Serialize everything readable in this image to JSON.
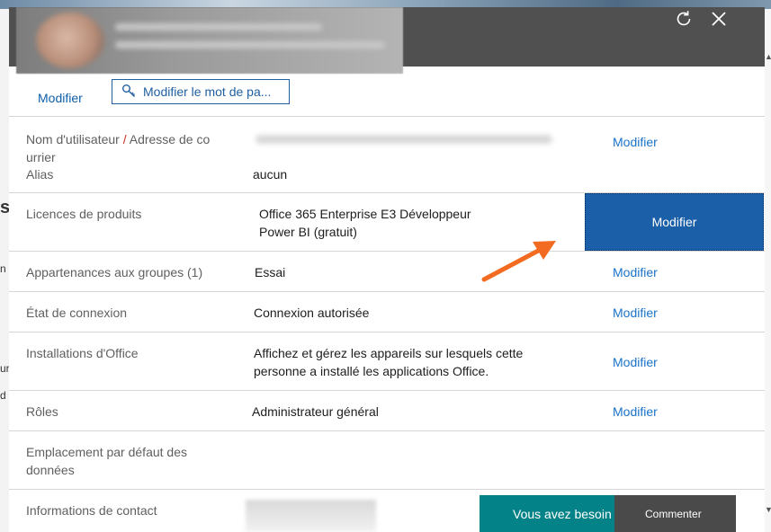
{
  "header": {
    "refresh_icon": "refresh-icon",
    "close_icon": "close-icon"
  },
  "toolbar": {
    "edit_label": "Modifier",
    "change_password_label": "Modifier le mot de pa..."
  },
  "rows": {
    "username": {
      "label_part1": "Nom d'utilisateur",
      "separator": "/",
      "label_part2": "Adresse de co",
      "label_part3": "urrier",
      "alias_label": "Alias",
      "alias_value": "aucun",
      "action": "Modifier"
    },
    "licenses": {
      "label": "Licences de produits",
      "value_line1": "Office 365 Enterprise E3 Développeur",
      "value_line2": "Power BI (gratuit)",
      "action": "Modifier"
    },
    "groups": {
      "label": "Appartenances aux groupes (1)",
      "value": "Essai",
      "action": "Modifier"
    },
    "signin": {
      "label": "État de connexion",
      "value": "Connexion autorisée",
      "action": "Modifier"
    },
    "office_installs": {
      "label": "Installations d'Office",
      "value_line1": "Affichez et gérez les appareils sur lesquels cette",
      "value_line2": "personne a installé les applications Office.",
      "action": "Modifier"
    },
    "roles": {
      "label": "Rôles",
      "value": "Administrateur général",
      "action": "Modifier"
    },
    "data_location": {
      "label_line1": "Emplacement par défaut des",
      "label_line2": "données"
    },
    "contact": {
      "label": "Informations de contact"
    }
  },
  "footer": {
    "help_label": "Vous avez besoin d'aide ?",
    "feedback_label": "Commenter"
  },
  "colors": {
    "link": "#1a73c9",
    "header": "#505050",
    "primary_button": "#1b5fa8",
    "help_bar": "#038387",
    "feedback_bar": "#4a4a4a",
    "annotation_arrow": "#f26b21"
  }
}
